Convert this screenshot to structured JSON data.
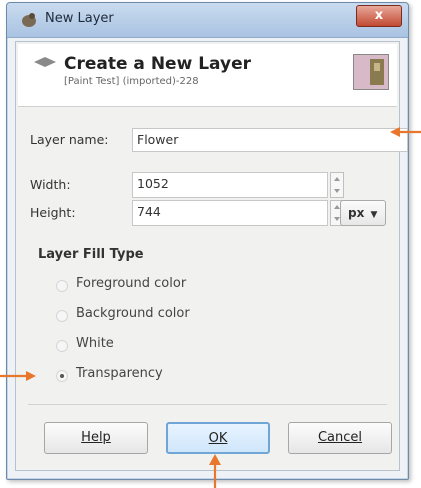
{
  "window": {
    "title": "New Layer",
    "close_label": "x"
  },
  "header": {
    "title": "Create a New Layer",
    "subtitle": "[Paint Test] (imported)-228"
  },
  "form": {
    "layer_name_label": "Layer name:",
    "layer_name_value": "Flower",
    "width_label": "Width:",
    "width_value": "1052",
    "height_label": "Height:",
    "height_value": "744",
    "unit_value": "px"
  },
  "fill_type": {
    "title": "Layer Fill Type",
    "options": [
      {
        "label": "Foreground color",
        "selected": false
      },
      {
        "label": "Background color",
        "selected": false
      },
      {
        "label": "White",
        "selected": false
      },
      {
        "label": "Transparency",
        "selected": true
      }
    ]
  },
  "buttons": {
    "help": "Help",
    "ok": "OK",
    "cancel": "Cancel"
  },
  "colors": {
    "annotation_arrow": "#e8762c",
    "default_button_border": "#70a6d6"
  },
  "icons": [
    "gimp-wilber-icon",
    "layer-icon",
    "layer-preview-icon",
    "annotation-arrow-icon"
  ]
}
